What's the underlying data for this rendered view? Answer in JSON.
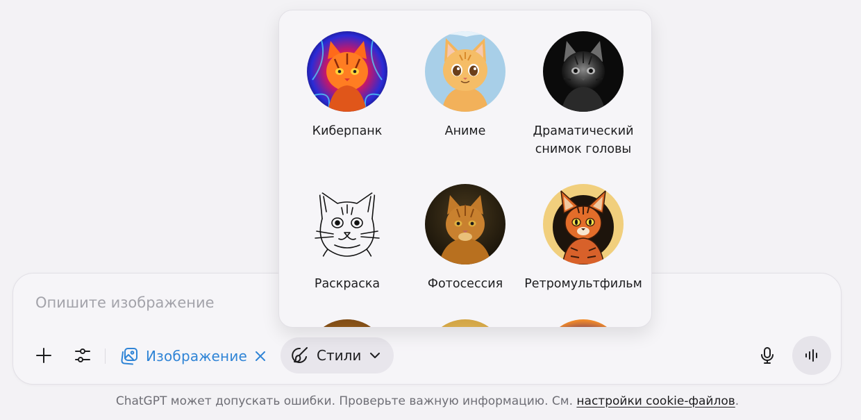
{
  "composer": {
    "placeholder": "Опишите изображение",
    "tools": {
      "add": "plus-icon",
      "settings": "sliders-icon"
    },
    "image_chip": {
      "label": "Изображение",
      "color": "#2f84d6"
    },
    "styles_button": {
      "label": "Стили"
    }
  },
  "styles_menu": {
    "items": [
      {
        "label": "Киберпанк",
        "icon": "cyberpunk-cat-thumbnail"
      },
      {
        "label": "Аниме",
        "icon": "anime-cat-thumbnail"
      },
      {
        "label": "Драматический снимок головы",
        "icon": "dramatic-headshot-cat-thumbnail"
      },
      {
        "label": "Раскраска",
        "icon": "coloring-page-cat-thumbnail"
      },
      {
        "label": "Фотосессия",
        "icon": "photoshoot-cat-thumbnail"
      },
      {
        "label": "Ретромультфильм",
        "icon": "retro-cartoon-cat-thumbnail"
      }
    ]
  },
  "footer": {
    "text": "ChatGPT может допускать ошибки. Проверьте важную информацию. См. ",
    "link": "настройки cookie-файлов",
    "end": "."
  }
}
